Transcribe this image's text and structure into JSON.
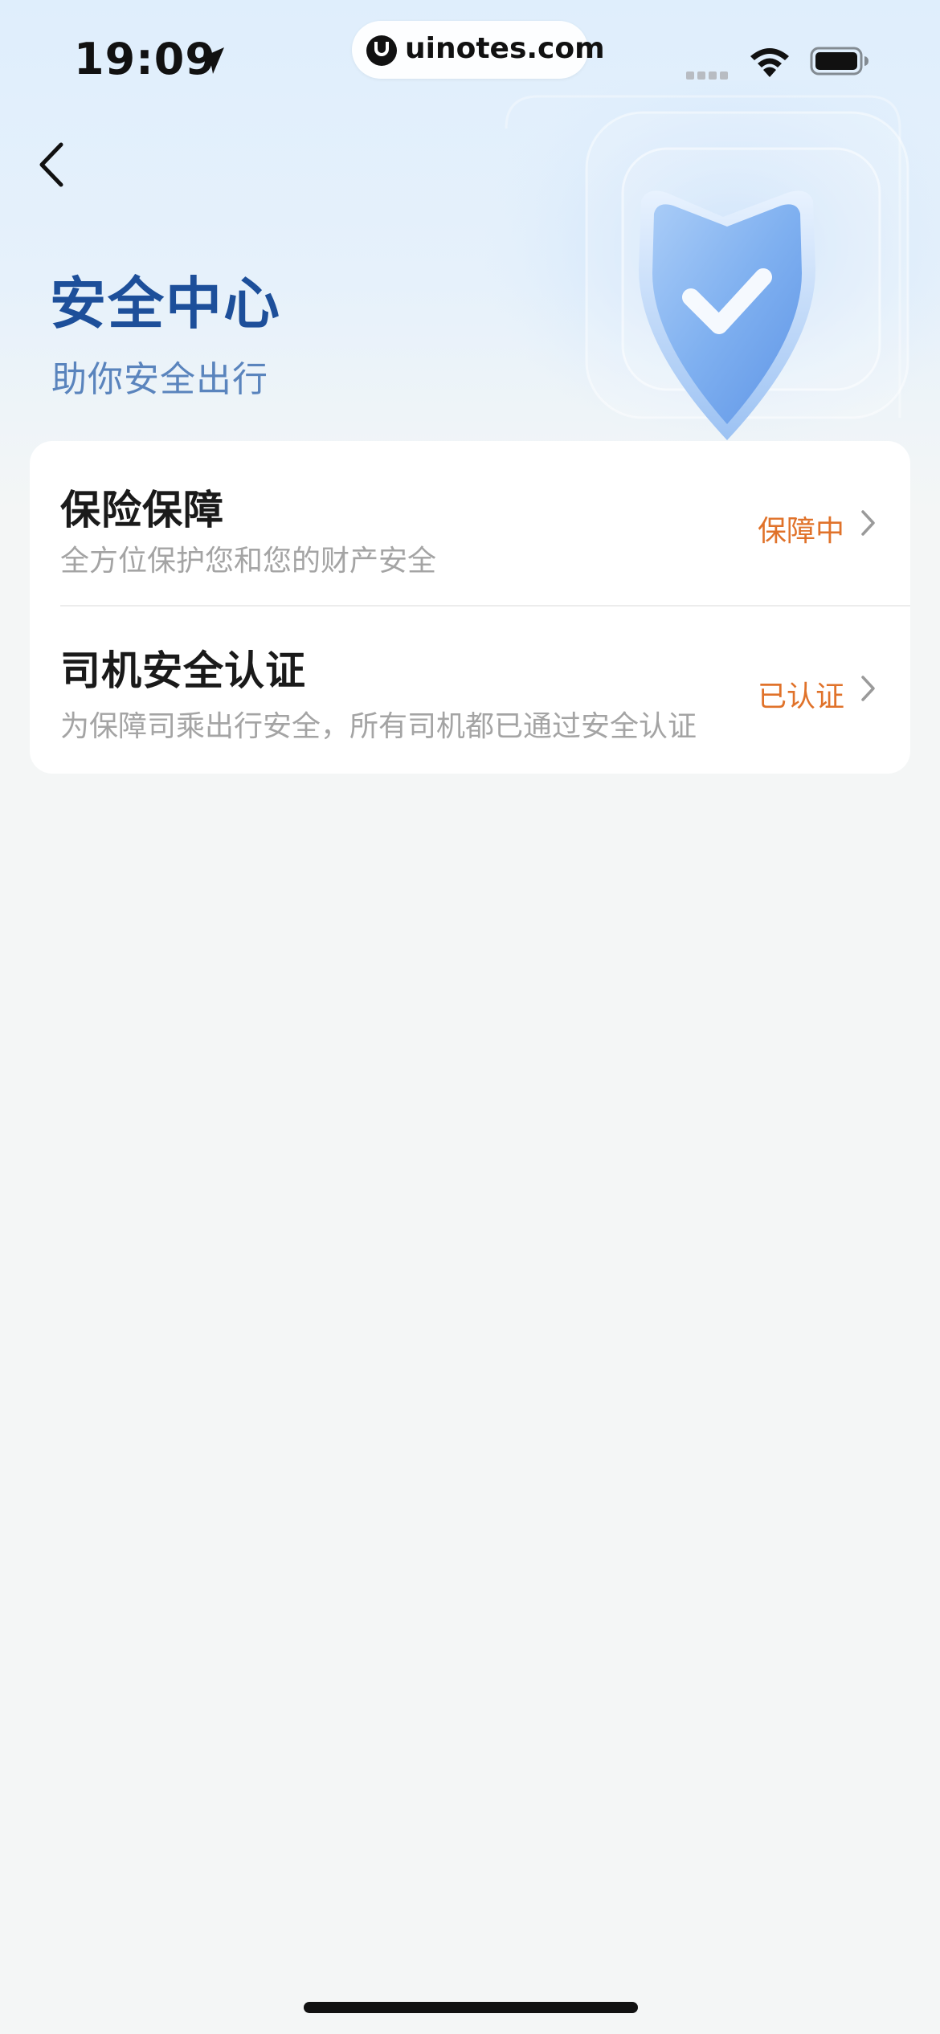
{
  "status_bar": {
    "time": "19:09",
    "url": "uinotes.com"
  },
  "header": {
    "title": "安全中心",
    "subtitle": "助你安全出行"
  },
  "items": [
    {
      "title": "保险保障",
      "description": "全方位保护您和您的财产安全",
      "status": "保障中"
    },
    {
      "title": "司机安全认证",
      "description": "为保障司乘出行安全，所有司机都已通过安全认证",
      "status": "已认证"
    }
  ],
  "colors": {
    "title": "#1d4f9a",
    "subtitle": "#5a84bd",
    "status_accent": "#e0722a",
    "background": "#f4f6f6"
  },
  "icons": {
    "back": "back-icon",
    "shield": "shield-check-icon",
    "chevron": "chevron-right-icon",
    "location": "location-arrow-icon",
    "wifi": "wifi-icon",
    "battery": "battery-icon"
  }
}
